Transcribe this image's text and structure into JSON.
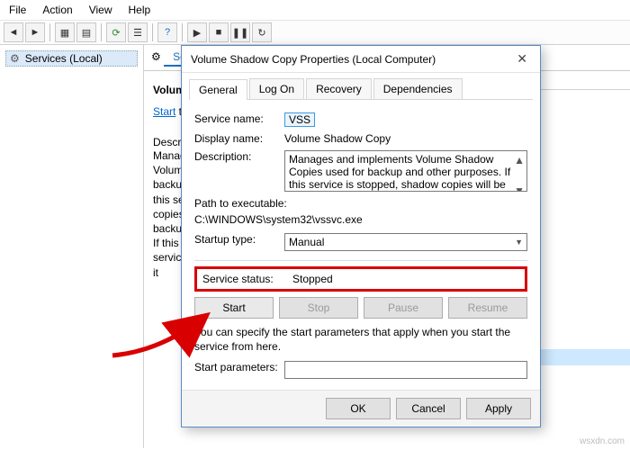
{
  "menubar": [
    "File",
    "Action",
    "View",
    "Help"
  ],
  "tree": {
    "node": "Services (Local)"
  },
  "detail": {
    "tab": "Services",
    "title": "Volume Sha",
    "linkText": "Start",
    "linkSuffix": " the serv",
    "descLabel": "Description:",
    "descText": "Manages and implements Volume Shadow Copies used for backup and other purposes. If this service is stopped, shadow copies will be unavailable for backup and the backup may fail. If this service is disabled, any services that explicitly depend on it"
  },
  "list": {
    "headers": [
      "Status",
      "Startu"
    ],
    "rows": [
      [
        "",
        "Manu"
      ],
      [
        "Running",
        "Autor"
      ],
      [
        "",
        "Manu"
      ],
      [
        "",
        "Manu"
      ],
      [
        "",
        "Manu"
      ],
      [
        "",
        "Manu"
      ],
      [
        "",
        "Manu"
      ],
      [
        "",
        "Disab"
      ],
      [
        "Running",
        "Autor"
      ],
      [
        "Running",
        "Autor"
      ],
      [
        "",
        "Manu"
      ],
      [
        "",
        ""
      ],
      [
        "Running",
        "Autor"
      ],
      [
        "Running",
        "Autor"
      ],
      [
        "Running",
        "Autor"
      ],
      [
        "Running",
        "Autor"
      ],
      [
        "",
        "Manu"
      ],
      [
        "",
        "Manu"
      ],
      [
        "",
        "Manu"
      ],
      [
        "",
        "Manu"
      ],
      [
        "",
        "Manu"
      ]
    ]
  },
  "dialog": {
    "title": "Volume Shadow Copy Properties (Local Computer)",
    "tabs": [
      "General",
      "Log On",
      "Recovery",
      "Dependencies"
    ],
    "serviceNameLabel": "Service name:",
    "serviceName": "VSS",
    "displayNameLabel": "Display name:",
    "displayName": "Volume Shadow Copy",
    "descriptionLabel": "Description:",
    "description": "Manages and implements Volume Shadow Copies used for backup and other purposes. If this service is stopped, shadow copies will be unavailable for",
    "pathLabel": "Path to executable:",
    "path": "C:\\WINDOWS\\system32\\vssvc.exe",
    "startupLabel": "Startup type:",
    "startupValue": "Manual",
    "statusLabel": "Service status:",
    "statusValue": "Stopped",
    "buttons": {
      "start": "Start",
      "stop": "Stop",
      "pause": "Pause",
      "resume": "Resume"
    },
    "note": "You can specify the start parameters that apply when you start the service from here.",
    "paramsLabel": "Start parameters:",
    "paramsValue": "",
    "footer": {
      "ok": "OK",
      "cancel": "Cancel",
      "apply": "Apply"
    }
  },
  "watermark": "wsxdn.com"
}
